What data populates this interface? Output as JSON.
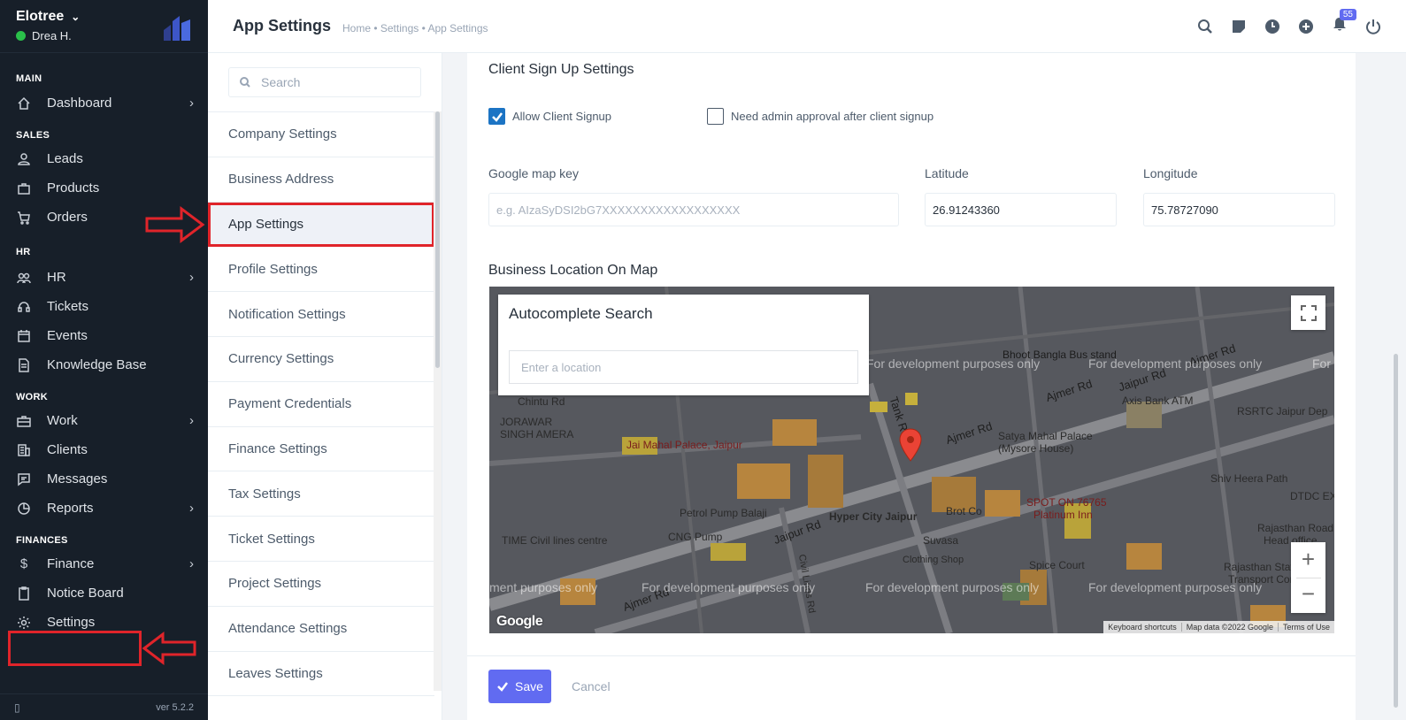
{
  "sidebar": {
    "company": "Elotree",
    "user": "Drea H.",
    "version": "ver 5.2.2",
    "sections": {
      "main": "MAIN",
      "sales": "SALES",
      "hr": "HR",
      "work": "WORK",
      "finances": "FINANCES"
    },
    "items": {
      "dashboard": "Dashboard",
      "leads": "Leads",
      "products": "Products",
      "orders": "Orders",
      "hr": "HR",
      "tickets": "Tickets",
      "events": "Events",
      "knowledge_base": "Knowledge Base",
      "work": "Work",
      "clients": "Clients",
      "messages": "Messages",
      "reports": "Reports",
      "finance": "Finance",
      "notice_board": "Notice Board",
      "settings": "Settings"
    }
  },
  "header": {
    "title": "App Settings",
    "breadcrumb": "Home • Settings • App Settings",
    "notification_count": "55"
  },
  "settings_menu": {
    "search_placeholder": "Search",
    "items": [
      "Company Settings",
      "Business Address",
      "App Settings",
      "Profile Settings",
      "Notification Settings",
      "Currency Settings",
      "Payment Credentials",
      "Finance Settings",
      "Tax Settings",
      "Ticket Settings",
      "Project Settings",
      "Attendance Settings",
      "Leaves Settings"
    ],
    "active_index": 2
  },
  "form": {
    "section_title": "Client Sign Up Settings",
    "allow_signup_label": "Allow Client Signup",
    "allow_signup_checked": true,
    "admin_approval_label": "Need admin approval after client signup",
    "admin_approval_checked": false,
    "map_key_label": "Google map key",
    "map_key_placeholder": "e.g. AIzaSyDSI2bG7XXXXXXXXXXXXXXXXXX",
    "latitude_label": "Latitude",
    "latitude_value": "26.91243360",
    "longitude_label": "Longitude",
    "longitude_value": "75.78727090",
    "map_title": "Business Location On Map",
    "save_label": "Save",
    "cancel_label": "Cancel"
  },
  "map": {
    "autocomplete_title": "Autocomplete Search",
    "autocomplete_placeholder": "Enter a location",
    "watermark": "For development purposes only",
    "watermark_partial_left": "ment purposes only",
    "watermark_partial_right": "For",
    "labels": {
      "bhoot_bangla": "Bhoot Bangla Bus stand",
      "ajmer_rd_top_right": "Ajmer Rd",
      "axis_bank": "Axis Bank ATM",
      "rsrtc": "RSRTC Jaipur Dep",
      "jaipur_rd": "Jaipur Rd",
      "ajmer_rd": "Ajmer Rd",
      "tank_rd": "Tank Rd",
      "chintu": "Chintu Rd",
      "jorawar": "JORAWAR",
      "singh_amera": "SINGH AMERA",
      "jai_mahal": "Jai Mahal Palace, Jaipur",
      "satya_mahal": "Satya Mahal Palace",
      "mysore_house": "(Mysore House)",
      "shiv_heera": "Shiv Heera Path",
      "petrol_pump": "Petrol Pump Balaji",
      "hyper_city": "Hyper City Jaipur",
      "brot_co": "Brot Co",
      "spot_on": "SPOT ON 76765",
      "platinum_inn": "Platinum Inn",
      "time_civil": "TIME Civil lines centre",
      "cng_pump": "CNG Pump",
      "suvasa": "Suvasa",
      "clothing_shop": "Clothing Shop",
      "jaipur_rd_lower": "Jaipur Rd",
      "spice_court": "Spice Court",
      "rajasthan_head": "Rajasthan Road",
      "head_office": "Head office",
      "rajasthan_state": "Rajasthan State Ro",
      "transport": "Transport Corporati",
      "dtdc": "DTDC EX",
      "ajmer_rd_bottom": "Ajmer Rd",
      "civil_lines_rd": "Civil Lines Rd"
    },
    "google": "Google",
    "footer": [
      "Keyboard shortcuts",
      "Map data ©2022 Google",
      "Terms of Use"
    ]
  }
}
